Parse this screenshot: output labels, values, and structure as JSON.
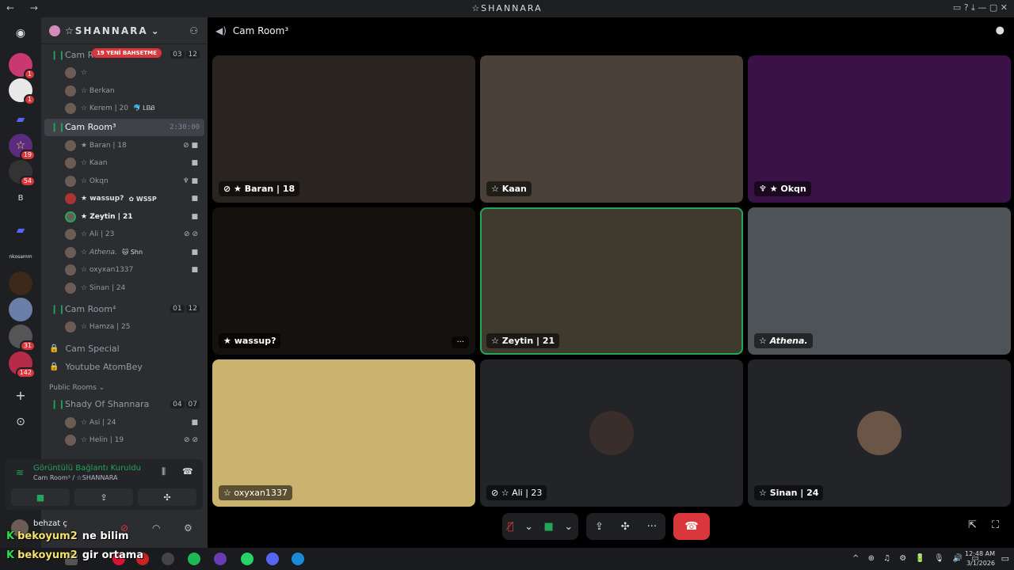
{
  "window": {
    "title": "☆SHANNARA",
    "nav_label": "← →",
    "controls": "▭ ? ⤓ — ▢ ✕"
  },
  "servers": {
    "items": [
      {
        "icon": "discord-icon",
        "label": "",
        "badge": ""
      },
      {
        "icon": "server-icon",
        "label": "",
        "badge": "1"
      },
      {
        "icon": "server-icon",
        "label": "",
        "badge": "1"
      },
      {
        "icon": "folder-icon",
        "label": "",
        "badge": ""
      },
      {
        "icon": "star-server-icon",
        "label": "",
        "badge": "19"
      },
      {
        "icon": "server-icon",
        "label": "",
        "badge": "54"
      },
      {
        "icon": "server-icon",
        "label": "B",
        "badge": ""
      },
      {
        "icon": "folder-icon",
        "label": "",
        "badge": ""
      },
      {
        "icon": "server-icon",
        "label": "nkosamm",
        "badge": ""
      },
      {
        "icon": "server-icon",
        "label": "",
        "badge": ""
      },
      {
        "icon": "server-icon",
        "label": "",
        "badge": ""
      },
      {
        "icon": "server-icon",
        "label": "",
        "badge": "31"
      },
      {
        "icon": "server-icon",
        "label": "",
        "badge": "142"
      },
      {
        "icon": "add-server-icon",
        "label": "+",
        "badge": ""
      },
      {
        "icon": "explore-icon",
        "label": "⊙",
        "badge": ""
      }
    ]
  },
  "sidebar": {
    "server_name": "☆SHANNARA",
    "chevron": "⌄",
    "room1": {
      "name": "Cam R",
      "pill": "19 YENİ BAHSETME",
      "count_a": "03",
      "count_b": "12"
    },
    "room1_users": [
      {
        "name": "☆",
        "tag": ""
      },
      {
        "name": "☆ Berkan",
        "tag": ""
      },
      {
        "name": "☆ Kerem | 20",
        "tag": "🐬 ᏞᏴᏰ"
      }
    ],
    "room2": {
      "name": "Cam Room³",
      "timer": "2:30:00"
    },
    "room2_users": [
      {
        "name": "★ Baran | 18",
        "tag": "",
        "icons": "⊘ ■"
      },
      {
        "name": "☆ Kaan",
        "tag": "",
        "icons": "■"
      },
      {
        "name": "☆ Okqn",
        "tag": "",
        "icons": "♆ ■"
      },
      {
        "name": "★ wassup?",
        "tag": "✿ WSSP",
        "icons": "■"
      },
      {
        "name": "★ Zeytin | 21",
        "tag": "",
        "icons": "■"
      },
      {
        "name": "☆ Ali | 23",
        "tag": "",
        "icons": "⊘ ⊘"
      },
      {
        "name": "☆ Athena.",
        "tag": "🐱 Shn",
        "icons": "■"
      },
      {
        "name": "☆ oxyxan1337",
        "tag": "",
        "icons": "■"
      },
      {
        "name": "☆ Sinan | 24",
        "tag": "",
        "icons": ""
      }
    ],
    "room3": {
      "name": "Cam Room⁴",
      "count_a": "01",
      "count_b": "12"
    },
    "room3_users": [
      {
        "name": "☆ Hamza | 25"
      }
    ],
    "locked": [
      "Cam Special",
      "Youtube AtomBey"
    ],
    "category": "Public Rooms ⌄",
    "room4": {
      "name": "Shady Of Shannara",
      "count_a": "04",
      "count_b": "07"
    },
    "room4_users": [
      {
        "name": "☆ Asi | 24",
        "icons": "■"
      },
      {
        "name": "☆ Helin | 19",
        "icons": "⊘ ⊘"
      }
    ]
  },
  "voice_panel": {
    "status": "Görüntülü Bağlantı Kuruldu",
    "location": "Cam Room³ / ☆SHANNARA"
  },
  "user_panel": {
    "name": "behzat ç"
  },
  "channel_header": {
    "title": "Cam Room³"
  },
  "tiles": [
    {
      "label": "⊘ ★ Baran | 18",
      "bg": "#2a2420"
    },
    {
      "label": "☆ Kaan",
      "bg": "#4a4038"
    },
    {
      "label": "♆ ★ Okqn",
      "bg": "#3a1248"
    },
    {
      "label": "★ wassup?",
      "bg": "#14110f"
    },
    {
      "label": "☆ Zeytin | 21",
      "bg": "#3e3a2e"
    },
    {
      "label": "☆ Athena.",
      "bg": "#4e5358"
    },
    {
      "label": "☆ oxyxan1337",
      "bg": "#c9b36f"
    },
    {
      "label": "⊘ ☆ Ali | 23",
      "bg": "#232428"
    },
    {
      "label": "☆ Sinan | 24",
      "bg": "#232428"
    }
  ],
  "call_controls": {
    "mute": "🎙̸",
    "video": "■",
    "chevron": "⌄",
    "share": "⇪",
    "activity": "✣",
    "more": "···",
    "end": "☎"
  },
  "overlay_chat": [
    {
      "nick": "bekoyum2",
      "text": "ne bilim"
    },
    {
      "nick": "bekoyum2",
      "text": "gir ortama"
    }
  ],
  "taskbar": {
    "time": "12:48 AM",
    "date": "3/1/2026",
    "tray": "^ ⊕ ♫ ⚙ 🔋 🎙 🔊 ▭"
  }
}
